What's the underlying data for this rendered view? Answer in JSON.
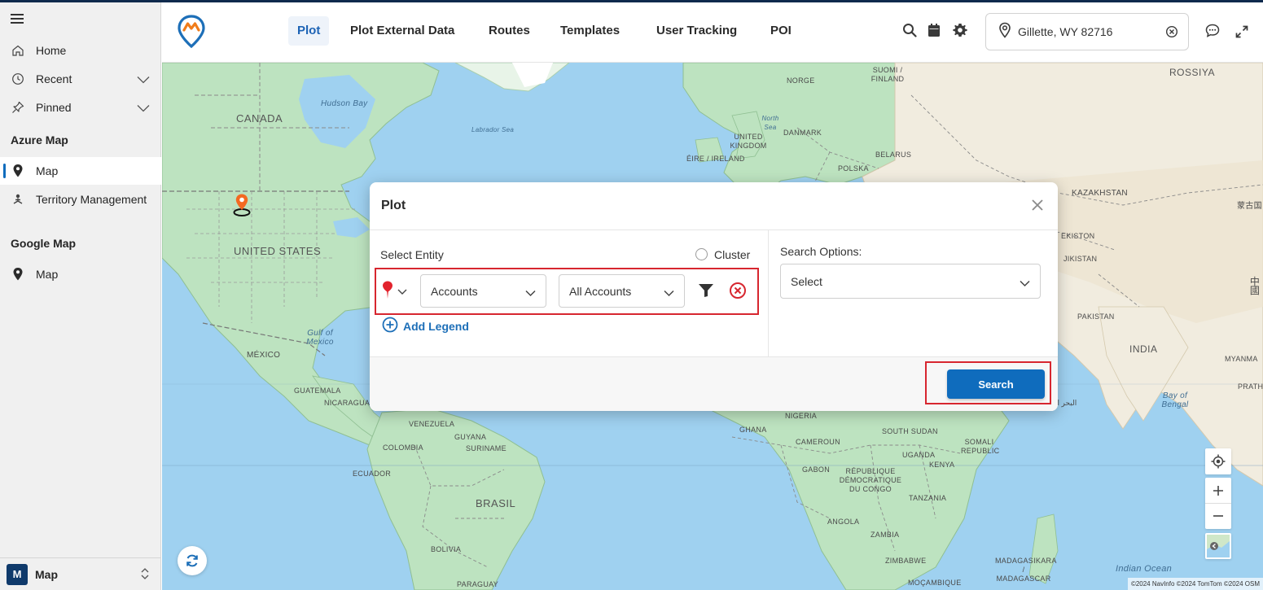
{
  "sidebar": {
    "menu_icon": "hamburger-icon",
    "home": {
      "label": "Home",
      "icon": "home-icon"
    },
    "recent": {
      "label": "Recent",
      "icon": "clock-icon"
    },
    "pinned": {
      "label": "Pinned",
      "icon": "pin-icon"
    },
    "sections": [
      {
        "title": "Azure Map",
        "items": [
          {
            "label": "Map",
            "icon": "location-pin-icon",
            "active": true
          },
          {
            "label": "Territory Management",
            "icon": "territory-icon",
            "active": false
          }
        ]
      },
      {
        "title": "Google Map",
        "items": [
          {
            "label": "Map",
            "icon": "location-pin-icon",
            "active": false
          }
        ]
      }
    ],
    "footer": {
      "badge": "M",
      "label": "Map"
    }
  },
  "header": {
    "logo_icon": "maplytics-logo-icon",
    "tabs": [
      {
        "label": "Plot",
        "active": true
      },
      {
        "label": "Plot External Data",
        "active": false
      },
      {
        "label": "Routes",
        "active": false
      },
      {
        "label": "Templates",
        "active": false
      },
      {
        "label": "User Tracking",
        "active": false
      },
      {
        "label": "POI",
        "active": false
      }
    ],
    "icons": [
      "search-icon",
      "calendar-icon",
      "gear-icon",
      "chat-icon",
      "expand-icon"
    ],
    "location": {
      "value": "Gillette, WY 82716",
      "icon": "location-pin-icon"
    }
  },
  "map": {
    "labels": {
      "canada": "CANADA",
      "united_states": "UNITED STATES",
      "mexico": "MÉXICO",
      "hudson_bay": "Hudson Bay",
      "labrador_sea": "Labrador Sea",
      "gulf_of_mexico": "Gulf of Mexico",
      "guatemala": "GUATEMALA",
      "nicaragua": "NICARAGUA",
      "venezuela": "VENEZUELA",
      "guyana": "GUYANA",
      "suriname": "SURINAME",
      "colombia": "COLOMBIA",
      "ecuador": "ECUADOR",
      "brasil": "BRASIL",
      "bolivia": "BOLIVIA",
      "paraguay": "PARAGUAY",
      "norge": "NORGE",
      "suomi_finland": "SUOMI / FINLAND",
      "north_sea": "North Sea",
      "denmark": "DANMARK",
      "united_kingdom": "UNITED KINGDOM",
      "eire_ireland": "ÉIRE / IRELAND",
      "belarus": "BELARUS",
      "polska": "POLSKA",
      "rossiya": "ROSSIYA",
      "kazakhstan": "KAZAKHSTAN",
      "mongolia": "蒙古国",
      "ekiston": "EKISTON",
      "tajikistan": "JIKISTAN",
      "pakistan": "PAKISTAN",
      "china": "中國",
      "india": "INDIA",
      "myanmar": "MYANMA",
      "prathet": "PRATHET",
      "bay_of_bengal": "Bay of Bengal",
      "arabic_sea": "البحر الأ",
      "nigeria": "NIGERIA",
      "ghana": "GHANA",
      "cameroun": "CAMEROUN",
      "south_sudan": "SOUTH SUDAN",
      "somali_republic": "SOMALI REPUBLIC",
      "gabon": "GABON",
      "rdc": "RÉPUBLIQUE DÉMOCRATIQUE DU CONGO",
      "uganda": "UGANDA",
      "kenya": "KENYA",
      "tanzania": "TANZANIA",
      "angola": "ANGOLA",
      "zambia": "ZAMBIA",
      "zimbabwe": "ZIMBABWE",
      "madagasikara": "MADAGASIKARA / MADAGASCAR",
      "mocambique": "MOÇAMBIQUE",
      "indian_ocean": "Indian Ocean"
    },
    "attribution": "©2024 NavInfo  ©2024 TomTom  ©2024 OSM",
    "controls": [
      "locate-icon",
      "zoom-in-icon",
      "zoom-out-icon",
      "map-style-icon"
    ],
    "refresh_icon": "refresh-icon",
    "marker_icon": "map-marker-icon"
  },
  "dialog": {
    "title": "Plot",
    "close_icon": "close-icon",
    "select_entity_label": "Select Entity",
    "cluster_label": "Cluster",
    "pin_color": "#e2232d",
    "entity": {
      "value": "Accounts"
    },
    "view": {
      "value": "All Accounts"
    },
    "filter_icon": "filter-icon",
    "remove_icon": "remove-circle-icon",
    "add_legend_label": "Add Legend",
    "search_options_label": "Search Options:",
    "search_options_select": {
      "value": "Select"
    },
    "search_button_label": "Search"
  }
}
